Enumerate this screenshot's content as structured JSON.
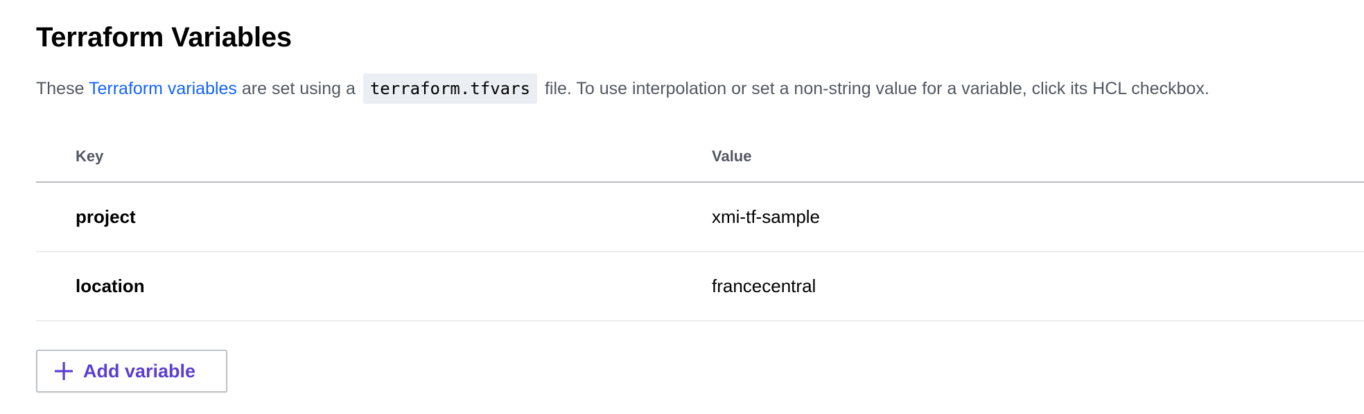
{
  "page": {
    "title": "Terraform Variables",
    "description": {
      "prefix": "These ",
      "link_text": "Terraform variables",
      "middle": " are set using a ",
      "code": "terraform.tfvars",
      "suffix": " file. To use interpolation or set a non-string value for a variable, click its HCL checkbox."
    }
  },
  "table": {
    "headers": {
      "key": "Key",
      "value": "Value"
    },
    "rows": [
      {
        "key": "project",
        "value": "xmi-tf-sample"
      },
      {
        "key": "location",
        "value": "francecentral"
      }
    ]
  },
  "actions": {
    "add_variable_label": "Add variable",
    "add_variable_icon": "plus-icon"
  },
  "colors": {
    "link": "#1563ff",
    "button_text": "#5b3fcf",
    "code_background": "#ebeef2",
    "muted_text": "#525761"
  }
}
